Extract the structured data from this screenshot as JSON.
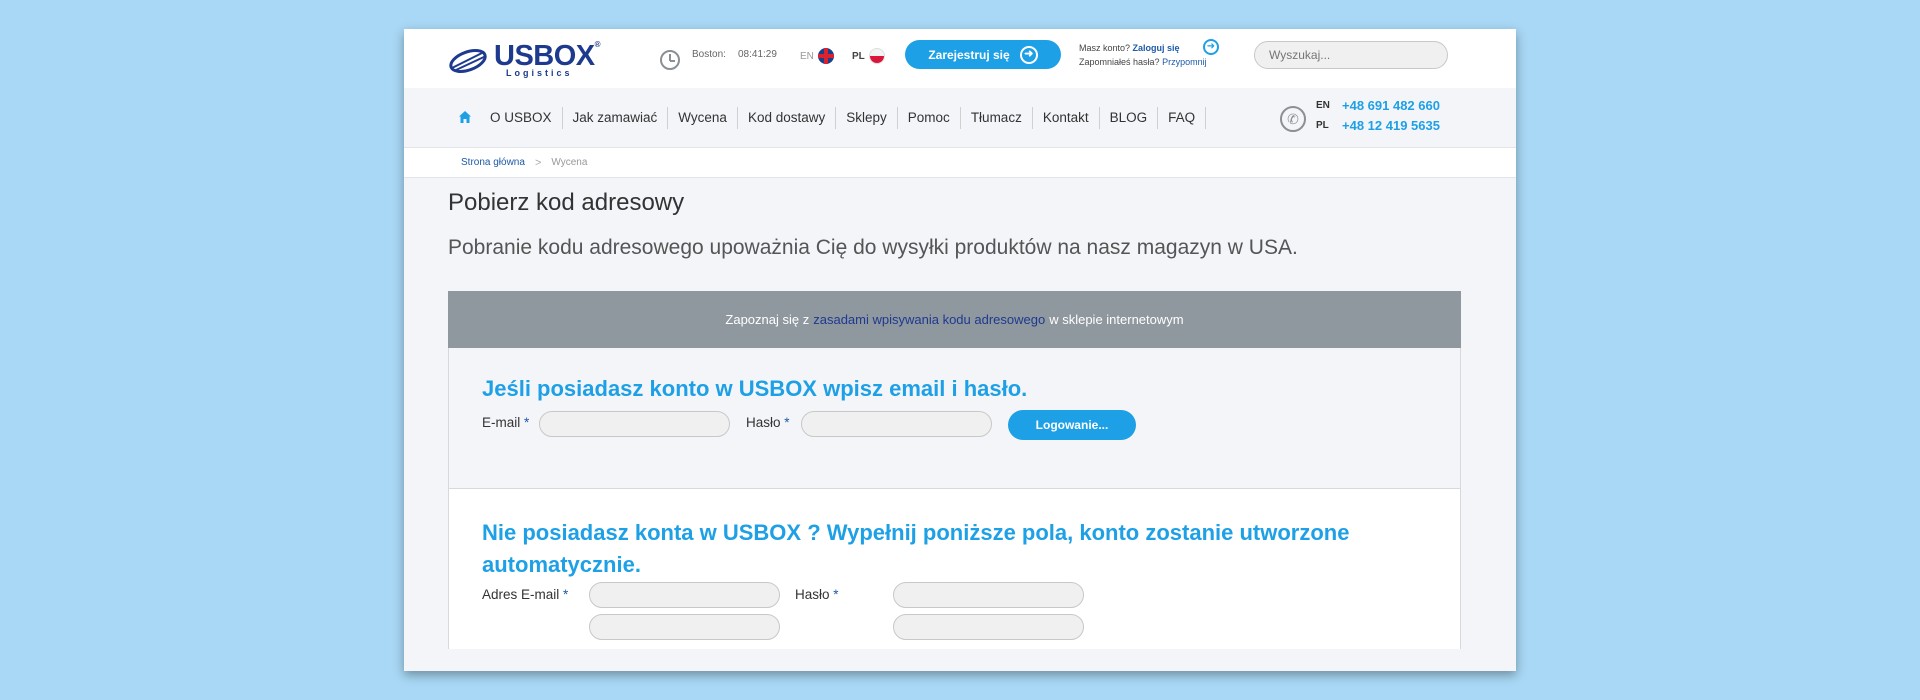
{
  "brand": {
    "name": "USBOX",
    "sub": "Logistics",
    "reg": "®"
  },
  "topbar": {
    "city": "Boston:",
    "time": "08:41:29",
    "lang_en": "EN",
    "lang_pl": "PL",
    "register_label": "Zarejestruj się",
    "account_prompt": "Masz konto?",
    "login_link": "Zaloguj się",
    "forgot_prompt": "Zapomniałeś hasła?",
    "remind_link": "Przypomnij",
    "search_placeholder": "Wyszukaj..."
  },
  "nav": {
    "items": [
      "O USBOX",
      "Jak zamawiać",
      "Wycena",
      "Kod dostawy",
      "Sklepy",
      "Pomoc",
      "Tłumacz",
      "Kontakt",
      "BLOG",
      "FAQ"
    ],
    "phones": [
      {
        "lang": "EN",
        "number": "+48 691 482 660"
      },
      {
        "lang": "PL",
        "number": "+48 12 419 5635"
      }
    ]
  },
  "breadcrumb": {
    "home": "Strona główna",
    "separator": ">",
    "current": "Wycena"
  },
  "main": {
    "title": "Pobierz kod adresowy",
    "subtitle": "Pobranie kodu adresowego upoważnia Cię do wysyłki produktów na nasz magazyn w USA.",
    "notice_before": "Zapoznaj się z",
    "notice_link": "zasadami wpisywania kodu adresowego",
    "notice_after": "w sklepie internetowym"
  },
  "login": {
    "heading": "Jeśli posiadasz konto w USBOX wpisz email i hasło.",
    "email_label": "E-mail",
    "password_label": "Hasło",
    "required_mark": "*",
    "button": "Logowanie..."
  },
  "register": {
    "heading_line1": "Nie posiadasz konta w USBOX ? Wypełnij poniższe pola, konto zostanie utworzone",
    "heading_line2": "automatycznie.",
    "email_label": "Adres E-mail",
    "password_label": "Hasło",
    "required_mark": "*"
  },
  "colors": {
    "accent": "#1ea0e6",
    "brand": "#1d3a8f",
    "notice_bg": "#8f979f",
    "background": "#a8d8f5"
  }
}
